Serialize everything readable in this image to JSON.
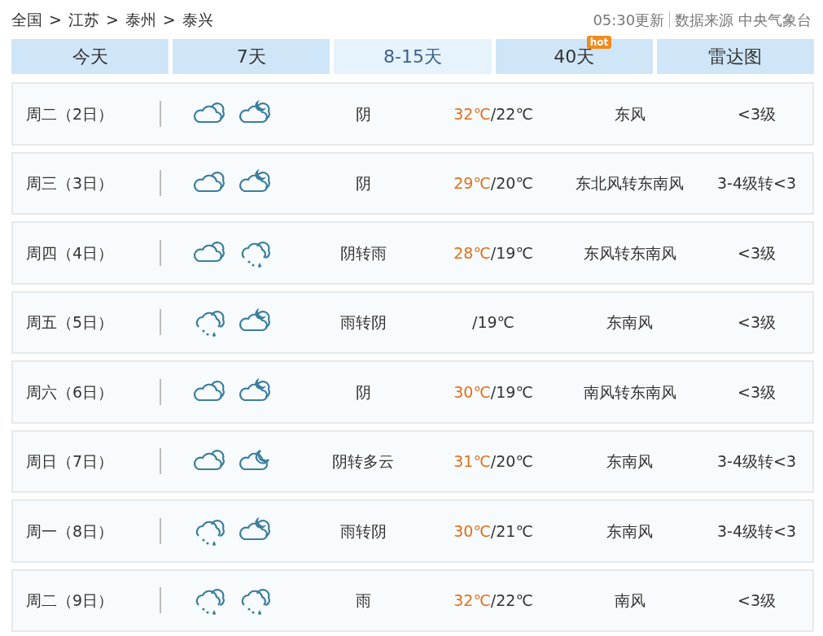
{
  "breadcrumb": [
    "全国",
    "江苏",
    "泰州",
    "泰兴"
  ],
  "breadcrumb_separator": ">",
  "update_time": "05:30更新",
  "source": "数据来源 中央气象台",
  "tabs": [
    {
      "label": "今天",
      "selected": false
    },
    {
      "label": "7天",
      "selected": false
    },
    {
      "label": "8-15天",
      "selected": true
    },
    {
      "label": "40天",
      "selected": false,
      "badge": "hot"
    },
    {
      "label": "雷达图",
      "selected": false
    }
  ],
  "days": [
    {
      "day": "周二（2日）",
      "icons": [
        {
          "kind": "cloudy"
        },
        {
          "kind": "cloudy-night"
        }
      ],
      "weather": "阴",
      "high": "32℃",
      "low": "/22℃",
      "wind": "东风",
      "level": "<3级"
    },
    {
      "day": "周三（3日）",
      "icons": [
        {
          "kind": "cloudy"
        },
        {
          "kind": "cloudy-night"
        }
      ],
      "weather": "阴",
      "high": "29℃",
      "low": "/20℃",
      "wind": "东北风转东南风",
      "level": "3-4级转<3"
    },
    {
      "day": "周四（4日）",
      "icons": [
        {
          "kind": "cloudy"
        },
        {
          "kind": "rain"
        }
      ],
      "weather": "阴转雨",
      "high": "28℃",
      "low": "/19℃",
      "wind": "东风转东南风",
      "level": "<3级"
    },
    {
      "day": "周五（5日）",
      "icons": [
        {
          "kind": "rain"
        },
        {
          "kind": "cloudy-night"
        }
      ],
      "weather": "雨转阴",
      "low": "/19℃",
      "wind": "东南风",
      "level": "<3级"
    },
    {
      "day": "周六（6日）",
      "icons": [
        {
          "kind": "cloudy"
        },
        {
          "kind": "cloudy-night"
        }
      ],
      "weather": "阴",
      "high": "30℃",
      "low": "/19℃",
      "wind": "南风转东南风",
      "level": "<3级"
    },
    {
      "day": "周日（7日）",
      "icons": [
        {
          "kind": "cloudy"
        },
        {
          "kind": "partly-cloudy-night"
        }
      ],
      "weather": "阴转多云",
      "high": "31℃",
      "low": "/20℃",
      "wind": "东南风",
      "level": "3-4级转<3"
    },
    {
      "day": "周一（8日）",
      "icons": [
        {
          "kind": "rain"
        },
        {
          "kind": "cloudy-night"
        }
      ],
      "weather": "雨转阴",
      "high": "30℃",
      "low": "/21℃",
      "wind": "东南风",
      "level": "3-4级转<3"
    },
    {
      "day": "周二（9日）",
      "icons": [
        {
          "kind": "rain"
        },
        {
          "kind": "rain"
        }
      ],
      "weather": "雨",
      "high": "32℃",
      "low": "/22℃",
      "wind": "南风",
      "level": "<3级"
    }
  ]
}
